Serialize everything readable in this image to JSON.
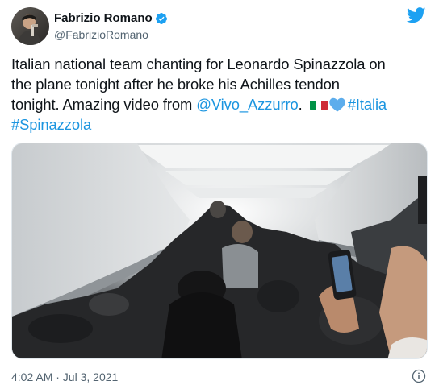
{
  "author": {
    "display_name": "Fabrizio Romano",
    "handle": "@FabrizioRomano",
    "verified": true,
    "avatar_icon": "profile-photo"
  },
  "brand": {
    "logo_icon": "twitter-bird-icon",
    "accent_color": "#1da1f2",
    "link_color": "#1b95e0"
  },
  "tweet": {
    "line1": "Italian national team chanting for Leonardo Spinazzola on",
    "line2": "the plane tonight after he broke his Achilles tendon",
    "line3_text": "tonight. Amazing video from ",
    "mention": "@Vivo_Azzurro",
    "after_mention": ". ",
    "emoji": [
      "italy-flag",
      "blue-heart"
    ],
    "hashtag1": "#Italia",
    "hashtag2": "#Spinazzola"
  },
  "media": {
    "type": "video",
    "description_icon": "video-thumbnail"
  },
  "footer": {
    "timestamp": "4:02 AM · Jul 3, 2021",
    "info_icon": "info-icon"
  }
}
